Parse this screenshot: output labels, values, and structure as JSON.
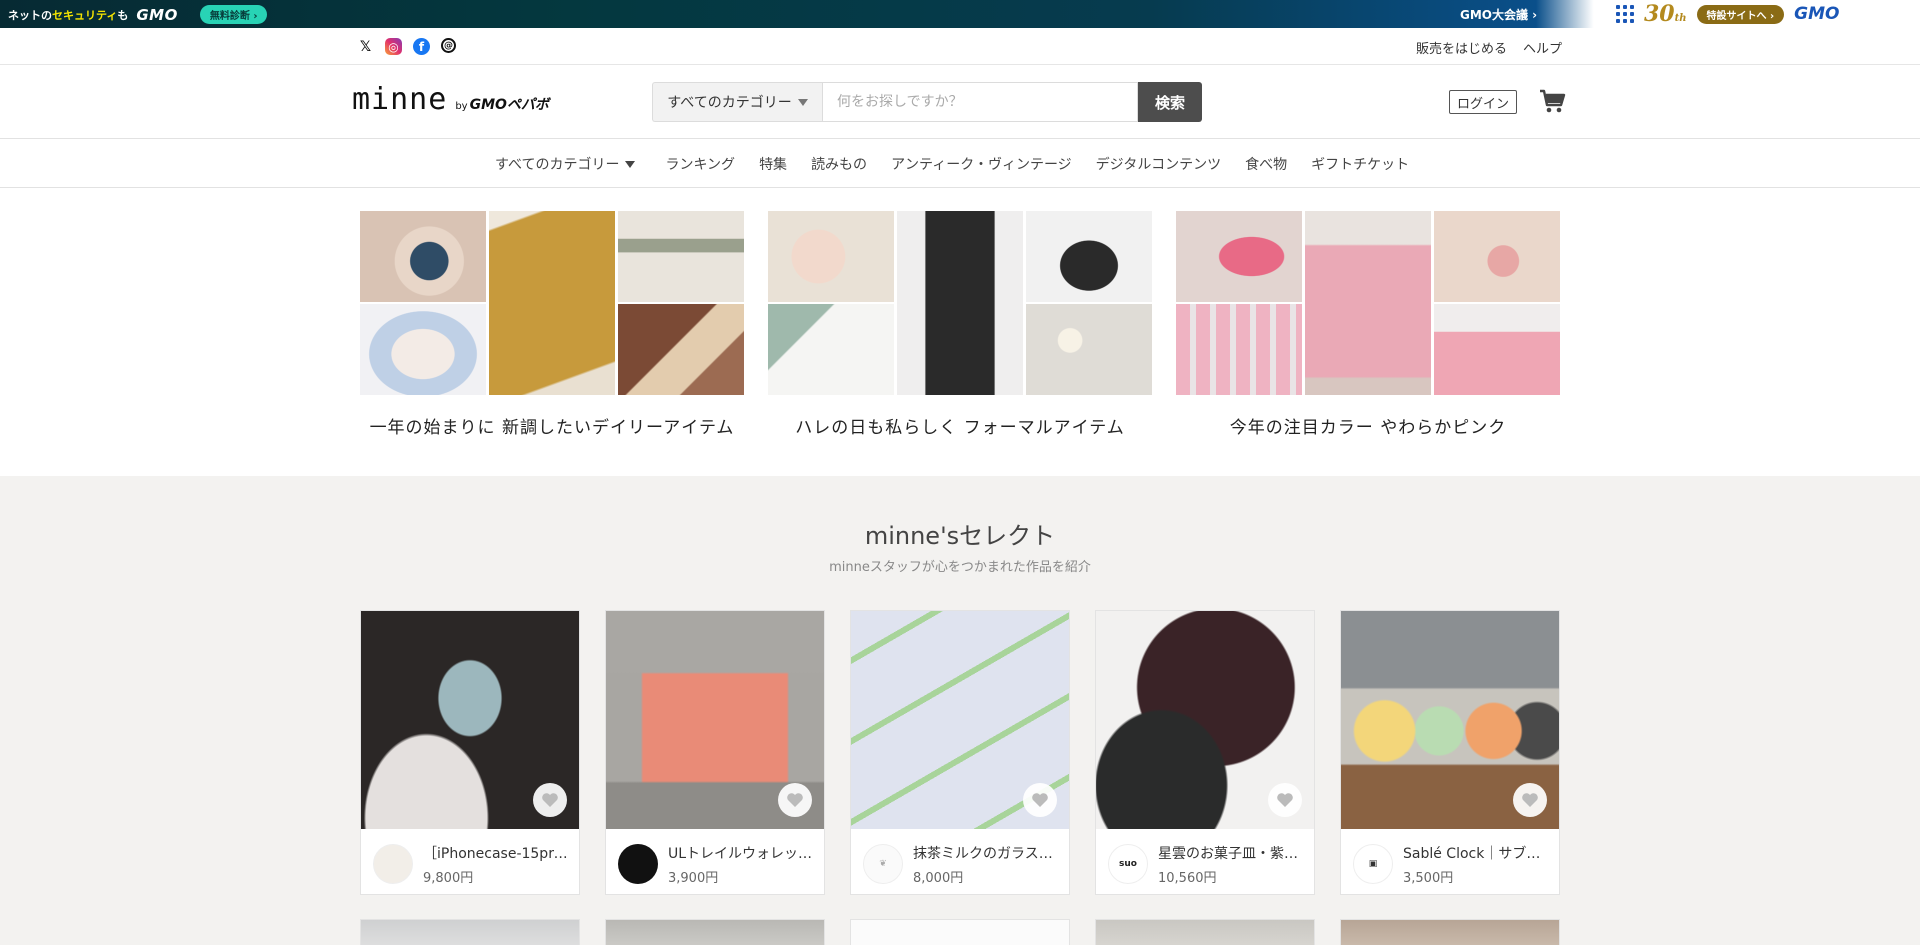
{
  "gmo_banner": {
    "left_text_pre": "ネットの",
    "left_text_highlight": "セキュリティ",
    "left_text_post": "も",
    "logo": "GMO",
    "diagnose_button": "無料診断 ›",
    "center_link": "GMO大会議 ›",
    "anniversary": "30",
    "anniversary_suffix": "th",
    "special_site": "特設サイトへ ›",
    "right_logo": "GMO"
  },
  "social": {
    "icons": [
      "x-icon",
      "instagram-icon",
      "facebook-icon",
      "threads-icon"
    ],
    "links": {
      "start_selling": "販売をはじめる",
      "help": "ヘルプ"
    }
  },
  "header": {
    "logo": "minne",
    "logo_by": "by",
    "logo_company": "GMOペパボ",
    "category_select": "すべてのカテゴリー",
    "search_placeholder": "何をお探しですか？",
    "search_button": "検索",
    "login": "ログイン"
  },
  "category_nav": {
    "all": "すべてのカテゴリー",
    "items": [
      "ランキング",
      "特集",
      "読みもの",
      "アンティーク・ヴィンテージ",
      "デジタルコンテンツ",
      "食べ物",
      "ギフトチケット"
    ]
  },
  "features": [
    {
      "caption": "一年の始まりに 新調したいデイリーアイテム"
    },
    {
      "caption": "ハレの日も私らしく フォーマルアイテム"
    },
    {
      "caption": "今年の注目カラー やわらかピンク"
    }
  ],
  "select": {
    "title": "minne'sセレクト",
    "subtitle": "minneスタッフが心をつかまれた作品を紹介",
    "products": [
      {
        "title": "［iPhonecase-15pro…",
        "price": "9,800円"
      },
      {
        "title": "ULトレイルウォレッ…",
        "price": "3,900円"
      },
      {
        "title": "抹茶ミルクのガラス…",
        "price": "8,000円"
      },
      {
        "title": "星雲のお菓子皿・紫…",
        "price": "10,560円"
      },
      {
        "title": "Sablé Clock｜サブレ…",
        "price": "3,500円"
      }
    ]
  }
}
